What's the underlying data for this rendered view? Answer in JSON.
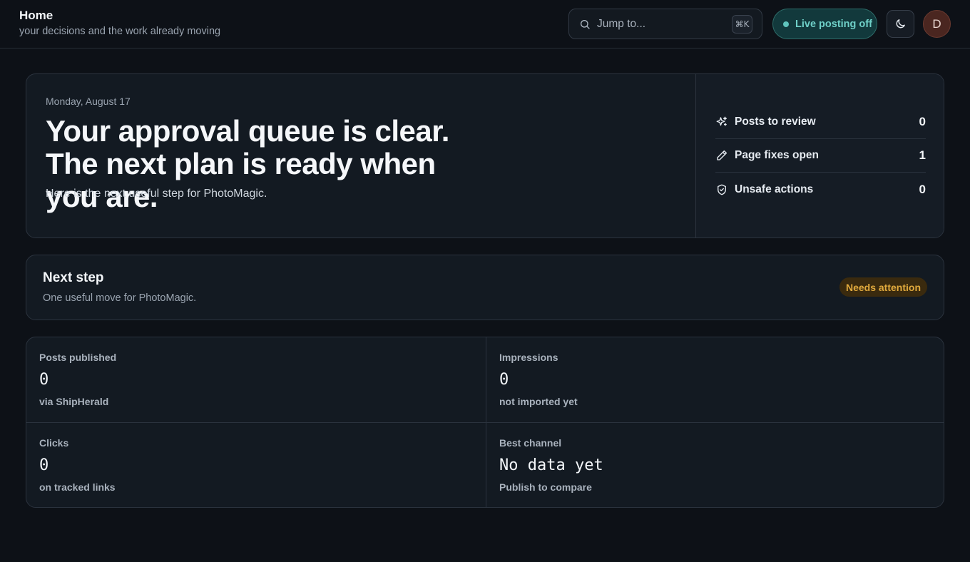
{
  "header": {
    "title": "Home",
    "subtitle": "your decisions and the work already moving",
    "search_placeholder": "Jump to...",
    "search_shortcut": "⌘K",
    "live_posting_label": "Live posting off",
    "avatar_initial": "D"
  },
  "hero": {
    "date": "Monday, August 17",
    "headline": "Your approval queue is clear. The next plan is ready when you are.",
    "description": "Here is the next useful step for PhotoMagic.",
    "stats": [
      {
        "label": "Posts to review",
        "value": "0",
        "icon": "sparkle-icon"
      },
      {
        "label": "Page fixes open",
        "value": "1",
        "icon": "pencil-icon"
      },
      {
        "label": "Unsafe actions",
        "value": "0",
        "icon": "shield-icon"
      }
    ]
  },
  "next_step": {
    "title": "Next step",
    "subtitle": "One useful move for PhotoMagic.",
    "badge": "Needs attention"
  },
  "metrics": [
    {
      "label": "Posts published",
      "value": "0",
      "sub": "via ShipHerald"
    },
    {
      "label": "Impressions",
      "value": "0",
      "sub": "not imported yet"
    },
    {
      "label": "Clicks",
      "value": "0",
      "sub": "on tracked links"
    },
    {
      "label": "Best channel",
      "value": "No data yet",
      "sub": "Publish to compare"
    }
  ],
  "colors": {
    "background": "#0d1117",
    "card": "#131a22",
    "accent_teal": "#6fd0c8",
    "warning": "#e0a93d"
  }
}
